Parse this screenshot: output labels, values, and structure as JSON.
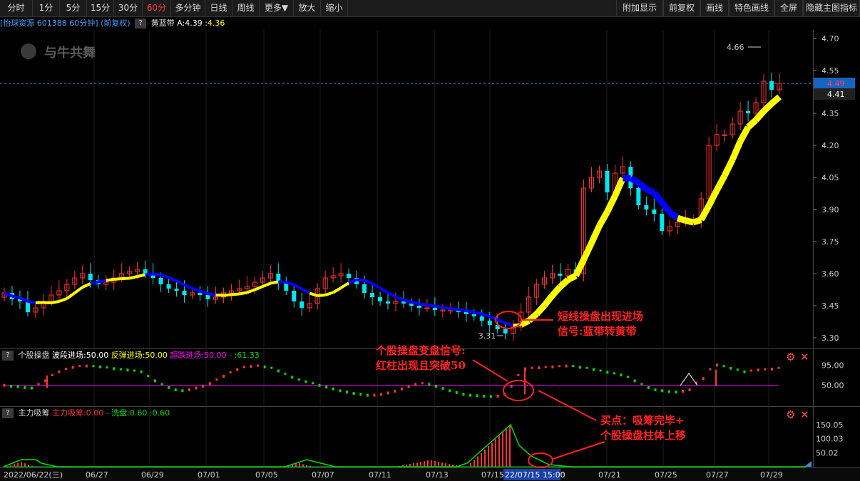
{
  "toolbar": {
    "left": [
      "分时",
      "1分",
      "5分",
      "15分",
      "30分",
      "60分",
      "多分钟",
      "日线",
      "周线",
      "更多▼",
      "放大",
      "缩小"
    ],
    "active_index": 5,
    "right": [
      "附加显示",
      "前复权",
      "画线",
      "特色画线",
      "全屏",
      "隐藏主图指标"
    ]
  },
  "header": {
    "stock_name": "[怡球资源",
    "stock_code": "601388",
    "period": "60分钟]",
    "adjust": "(前复权)",
    "q": "?",
    "indicator_name": "黄蓝带",
    "indicator_a": "A:4.39",
    "indicator_b": ":4.36"
  },
  "watermark": "与牛共舞",
  "panel2": {
    "q": "?",
    "name": "个股操盘",
    "l1": "波段进场:50.00",
    "l2": "反弹进场:50.00",
    "l3": "超跌进场:50.00",
    "l4": ":61.33",
    "dash": "-"
  },
  "panel3": {
    "q": "?",
    "name": "主力吸筹",
    "l1": "主力吸筹:0.00",
    "dash": "-",
    "l2": "洗盘:0.60",
    "l3": ":0.60"
  },
  "price_axis": [
    "4.70",
    "4.55",
    "4.35",
    "4.20",
    "4.05",
    "3.90",
    "3.75",
    "3.60",
    "3.45",
    "3.30"
  ],
  "price_current": "4.49",
  "price_secondary": "4.41",
  "price_high_label": "4.66",
  "price_low_label": "3.31",
  "ind2_axis": [
    "95.00",
    "50.00"
  ],
  "ind3_axis": [
    "150.05",
    "100.03",
    "50.02"
  ],
  "dates": [
    "2022/06/22(三)",
    "06/27",
    "06/29",
    "07/01",
    "07/05",
    "07/07",
    "07/11",
    "07/13",
    "07/15",
    "07/21",
    "07/25",
    "07/27",
    "07/29"
  ],
  "date_highlight": "22/07/15 15:00",
  "annotations": {
    "a1_line1": "短线操盘出现进场",
    "a1_line2": "信号:蓝带转黄带",
    "a2_line1": "个股操盘变盘信号:",
    "a2_line2": "红柱出现且突破50",
    "a3_line1": "买点：吸筹完毕+",
    "a3_line2": "个股操盘柱体上移"
  },
  "colors": {
    "up": "#ff3333",
    "down": "#00e5ee",
    "yellow": "#ffff00",
    "blue": "#0000ff",
    "magenta": "#ff00ff",
    "green": "#00dd00",
    "accent_red": "#ff2020"
  },
  "chart_data": {
    "type": "candlestick",
    "closes": [
      3.51,
      3.48,
      3.47,
      3.42,
      3.44,
      3.47,
      3.5,
      3.52,
      3.55,
      3.58,
      3.6,
      3.57,
      3.55,
      3.56,
      3.58,
      3.6,
      3.61,
      3.62,
      3.6,
      3.58,
      3.55,
      3.53,
      3.52,
      3.5,
      3.51,
      3.5,
      3.48,
      3.49,
      3.51,
      3.52,
      3.53,
      3.54,
      3.56,
      3.58,
      3.6,
      3.56,
      3.52,
      3.47,
      3.44,
      3.46,
      3.53,
      3.58,
      3.59,
      3.6,
      3.58,
      3.55,
      3.51,
      3.49,
      3.47,
      3.46,
      3.47,
      3.46,
      3.45,
      3.44,
      3.44,
      3.43,
      3.43,
      3.43,
      3.42,
      3.41,
      3.4,
      3.38,
      3.36,
      3.34,
      3.32,
      3.35,
      3.42,
      3.49,
      3.55,
      3.58,
      3.6,
      3.59,
      3.62,
      3.6,
      4.0,
      4.05,
      4.08,
      3.98,
      4.07,
      4.1,
      4.0,
      3.92,
      3.9,
      3.88,
      3.8,
      3.82,
      3.84,
      3.85,
      3.85,
      3.95,
      4.2,
      4.25,
      4.25,
      4.3,
      4.36,
      4.35,
      4.4,
      4.5,
      4.46,
      4.49
    ],
    "ind2_values": [
      50,
      48,
      47,
      45,
      44,
      52,
      60,
      72,
      80,
      86,
      90,
      92,
      93,
      92,
      91,
      89,
      87,
      85,
      84,
      82,
      80,
      70,
      60,
      52,
      45,
      40,
      38,
      40,
      44,
      48,
      54,
      62,
      70,
      78,
      85,
      90,
      92,
      93,
      91,
      88,
      82,
      75,
      68,
      62,
      58,
      54,
      50,
      46,
      42,
      38,
      35,
      32,
      30,
      28,
      28,
      30,
      33,
      37,
      42,
      47,
      52,
      54,
      52,
      48,
      43,
      38,
      34,
      30,
      28,
      27,
      26,
      25,
      26,
      30,
      48,
      72,
      86,
      88,
      89,
      90,
      91,
      92,
      93,
      92,
      90,
      88,
      85,
      82,
      79,
      76,
      73,
      68,
      60,
      52,
      45,
      40,
      38,
      36,
      35,
      37,
      40,
      55,
      65,
      85,
      95,
      92,
      88,
      84,
      80,
      82,
      84,
      85,
      86,
      88
    ],
    "ind2_axis": [
      95,
      50
    ],
    "ind3_red": [
      0,
      0,
      0,
      5,
      12,
      18,
      14,
      8,
      3,
      0,
      0,
      0,
      0,
      0,
      0,
      0,
      0,
      0,
      0,
      0,
      0,
      0,
      0,
      0,
      0,
      0,
      0,
      0,
      0,
      0,
      0,
      0,
      0,
      0,
      0,
      0,
      0,
      0,
      0,
      0,
      0,
      0,
      0,
      0,
      0,
      8,
      16,
      22,
      28,
      32,
      28,
      22,
      14,
      6,
      0,
      0,
      0,
      0,
      0,
      0,
      0,
      0,
      0,
      0,
      0,
      0,
      0,
      0,
      0,
      0,
      0,
      0,
      0,
      0,
      0,
      0,
      0,
      0,
      0,
      0,
      0,
      0,
      0,
      0,
      0,
      0,
      0,
      0,
      0,
      0,
      0,
      0,
      0,
      0,
      0,
      0,
      0,
      0,
      0,
      0,
      0,
      0,
      0,
      0,
      0,
      0,
      0,
      0
    ],
    "ind3_axis": [
      150.05,
      100.03,
      50.02
    ]
  }
}
